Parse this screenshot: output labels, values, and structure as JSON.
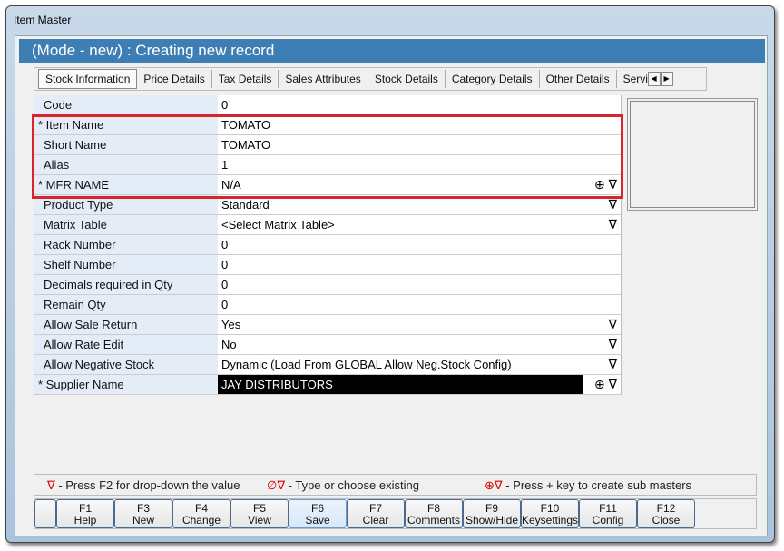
{
  "window": {
    "title": "Item Master"
  },
  "header": {
    "title": "(Mode - new) : Creating new record"
  },
  "tabs": [
    "Stock Information",
    "Price Details",
    "Tax Details",
    "Sales Attributes",
    "Stock Details",
    "Category Details",
    "Other Details",
    "Servi"
  ],
  "fields": [
    {
      "label": "Code",
      "value": "0",
      "required": false,
      "icons": ""
    },
    {
      "label": "* Item Name",
      "value": "TOMATO",
      "required": true,
      "icons": ""
    },
    {
      "label": "Short Name",
      "value": "TOMATO",
      "required": false,
      "icons": ""
    },
    {
      "label": "Alias",
      "value": "1",
      "required": false,
      "icons": ""
    },
    {
      "label": "* MFR NAME",
      "value": "N/A",
      "required": true,
      "icons": "⊕ ∇"
    },
    {
      "label": "Product Type",
      "value": "Standard",
      "required": false,
      "icons": "∇"
    },
    {
      "label": "Matrix Table",
      "value": "<Select Matrix Table>",
      "required": false,
      "icons": "∇"
    },
    {
      "label": "Rack Number",
      "value": "0",
      "required": false,
      "icons": ""
    },
    {
      "label": "Shelf Number",
      "value": "0",
      "required": false,
      "icons": ""
    },
    {
      "label": "Decimals required in Qty",
      "value": "0",
      "required": false,
      "icons": ""
    },
    {
      "label": "Remain Qty",
      "value": "0",
      "required": false,
      "icons": ""
    },
    {
      "label": "Allow Sale Return",
      "value": "Yes",
      "required": false,
      "icons": "∇"
    },
    {
      "label": "Allow Rate Edit",
      "value": "No",
      "required": false,
      "icons": "∇"
    },
    {
      "label": "Allow Negative Stock",
      "value": "Dynamic (Load From GLOBAL Allow Neg.Stock Config)",
      "required": false,
      "icons": "∇"
    },
    {
      "label": "* Supplier Name",
      "value": "JAY DISTRIBUTORS",
      "required": true,
      "icons": "⊕ ∇"
    }
  ],
  "legend": [
    {
      "symbol": "∇",
      "text": " - Press F2 for drop-down the value"
    },
    {
      "symbol": "∅∇",
      "text": " - Type or choose existing"
    },
    {
      "symbol": "⊕∇",
      "text": " - Press + key to create sub masters"
    }
  ],
  "buttons": [
    {
      "key": "F1",
      "label": "Help"
    },
    {
      "key": "F3",
      "label": "New"
    },
    {
      "key": "F4",
      "label": "Change"
    },
    {
      "key": "F5",
      "label": "View"
    },
    {
      "key": "F6",
      "label": "Save"
    },
    {
      "key": "F7",
      "label": "Clear"
    },
    {
      "key": "F8",
      "label": "Comments"
    },
    {
      "key": "F9",
      "label": "Show/Hide"
    },
    {
      "key": "F10",
      "label": "Keysettings"
    },
    {
      "key": "F11",
      "label": "Config"
    },
    {
      "key": "F12",
      "label": "Close"
    }
  ],
  "colors": {
    "header": "#3d7fb4",
    "highlight": "#d8242c"
  }
}
